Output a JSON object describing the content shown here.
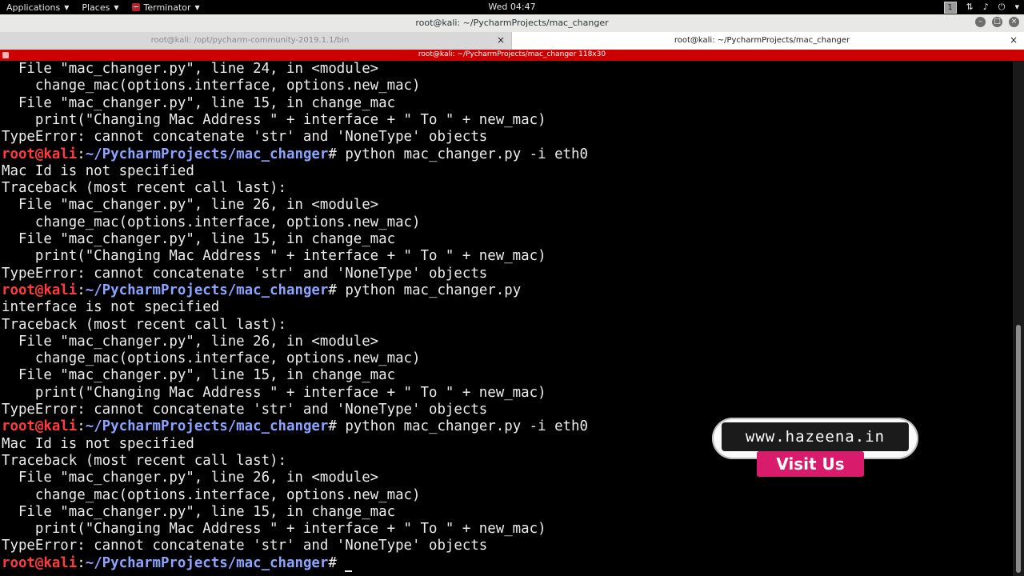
{
  "top_panel": {
    "applications": "Applications",
    "places": "Places",
    "terminator": "Terminator",
    "clock": "Wed 04:47",
    "workspace": "1"
  },
  "window": {
    "title": "root@kali: ~/PycharmProjects/mac_changer"
  },
  "tabs": [
    {
      "label": "root@kali: /opt/pycharm-community-2019.1.1/bin",
      "close": "×"
    },
    {
      "label": "root@kali: ~/PycharmProjects/mac_changer",
      "close": "×"
    }
  ],
  "terminal_strip": "root@kali: ~/PycharmProjects/mac_changer 118x30",
  "prompt": {
    "user": "root@kali",
    "colon": ":",
    "path": "~/PycharmProjects/mac_changer",
    "hash": "#"
  },
  "lines": [
    {
      "type": "text",
      "text": "  File \"mac_changer.py\", line 24, in <module>"
    },
    {
      "type": "text",
      "text": "    change_mac(options.interface, options.new_mac)"
    },
    {
      "type": "text",
      "text": "  File \"mac_changer.py\", line 15, in change_mac"
    },
    {
      "type": "text",
      "text": "    print(\"Changing Mac Address \" + interface + \" To \" + new_mac)"
    },
    {
      "type": "text",
      "text": "TypeError: cannot concatenate 'str' and 'NoneType' objects"
    },
    {
      "type": "prompt",
      "command": " python mac_changer.py -i eth0"
    },
    {
      "type": "text",
      "text": "Mac Id is not specified"
    },
    {
      "type": "text",
      "text": "Traceback (most recent call last):"
    },
    {
      "type": "text",
      "text": "  File \"mac_changer.py\", line 26, in <module>"
    },
    {
      "type": "text",
      "text": "    change_mac(options.interface, options.new_mac)"
    },
    {
      "type": "text",
      "text": "  File \"mac_changer.py\", line 15, in change_mac"
    },
    {
      "type": "text",
      "text": "    print(\"Changing Mac Address \" + interface + \" To \" + new_mac)"
    },
    {
      "type": "text",
      "text": "TypeError: cannot concatenate 'str' and 'NoneType' objects"
    },
    {
      "type": "prompt",
      "command": " python mac_changer.py"
    },
    {
      "type": "text",
      "text": "interface is not specified"
    },
    {
      "type": "text",
      "text": "Traceback (most recent call last):"
    },
    {
      "type": "text",
      "text": "  File \"mac_changer.py\", line 26, in <module>"
    },
    {
      "type": "text",
      "text": "    change_mac(options.interface, options.new_mac)"
    },
    {
      "type": "text",
      "text": "  File \"mac_changer.py\", line 15, in change_mac"
    },
    {
      "type": "text",
      "text": "    print(\"Changing Mac Address \" + interface + \" To \" + new_mac)"
    },
    {
      "type": "text",
      "text": "TypeError: cannot concatenate 'str' and 'NoneType' objects"
    },
    {
      "type": "prompt",
      "command": " python mac_changer.py -i eth0"
    },
    {
      "type": "text",
      "text": "Mac Id is not specified"
    },
    {
      "type": "text",
      "text": "Traceback (most recent call last):"
    },
    {
      "type": "text",
      "text": "  File \"mac_changer.py\", line 26, in <module>"
    },
    {
      "type": "text",
      "text": "    change_mac(options.interface, options.new_mac)"
    },
    {
      "type": "text",
      "text": "  File \"mac_changer.py\", line 15, in change_mac"
    },
    {
      "type": "text",
      "text": "    print(\"Changing Mac Address \" + interface + \" To \" + new_mac)"
    },
    {
      "type": "text",
      "text": "TypeError: cannot concatenate 'str' and 'NoneType' objects"
    },
    {
      "type": "prompt",
      "command": " "
    }
  ],
  "watermark": {
    "url": "www.hazeena.in",
    "cta": "Visit Us"
  },
  "colors": {
    "prompt_user": "#ff3b3b",
    "prompt_path": "#8aa4ff",
    "strip": "#cc0000",
    "watermark_cta": "#d81b6b"
  },
  "icons": {
    "terminator": "terminal-icon",
    "network": "network-icon",
    "volume": "volume-icon",
    "power": "power-icon"
  }
}
